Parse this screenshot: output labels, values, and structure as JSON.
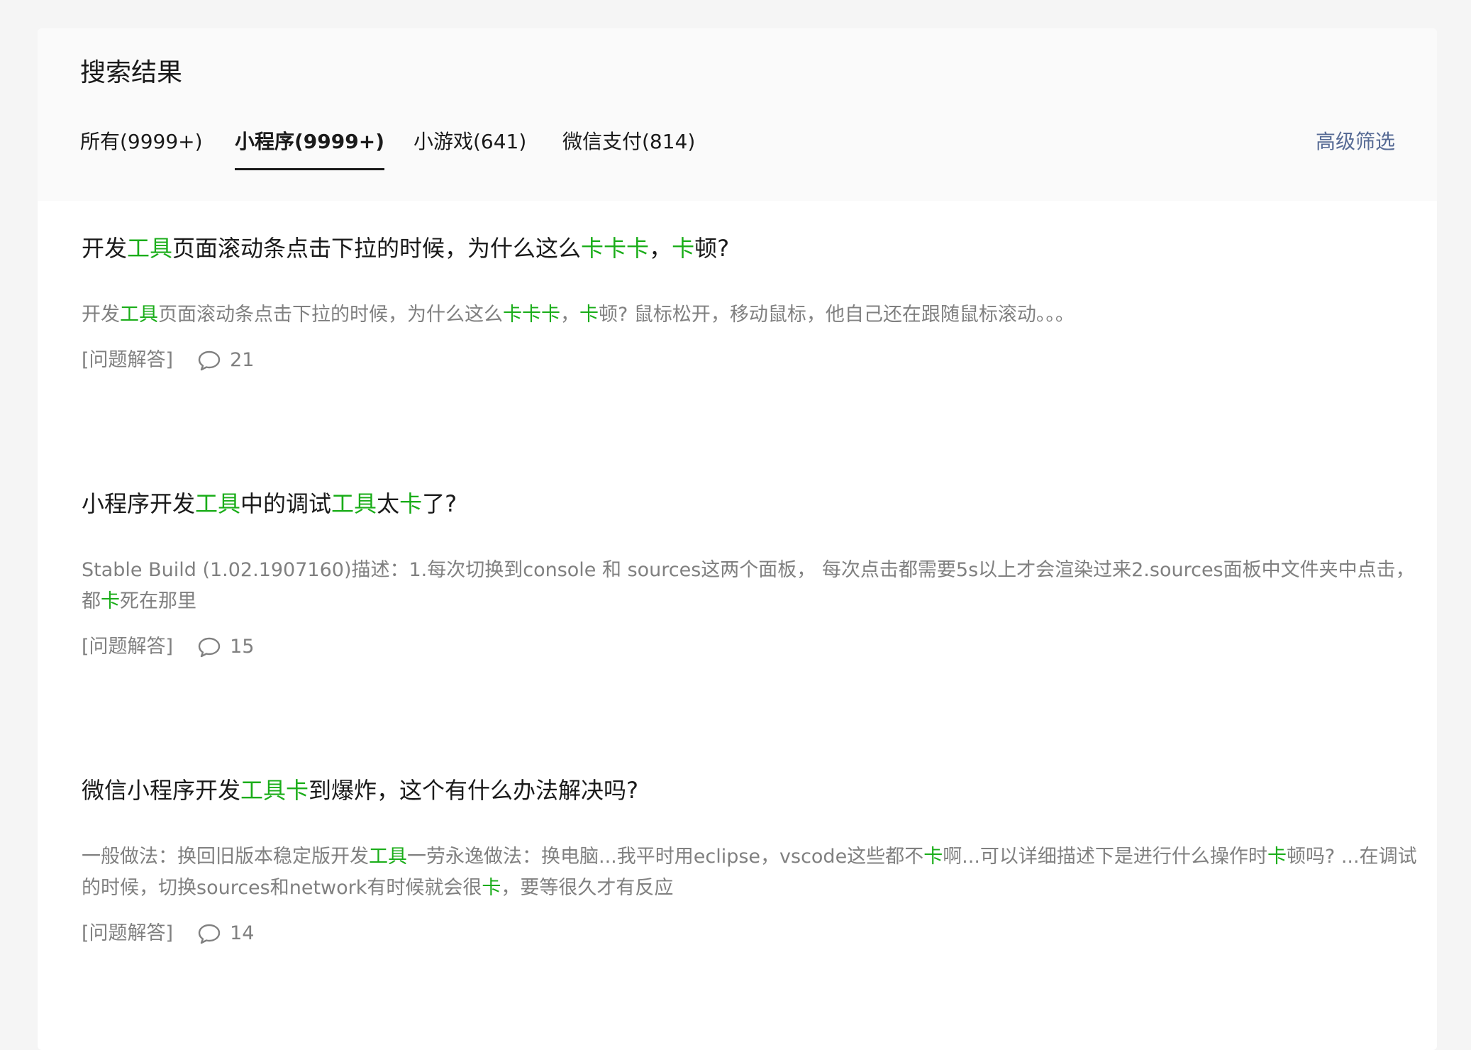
{
  "page_title": "搜索结果",
  "tabs": [
    {
      "label": "所有(9999+)",
      "active": false
    },
    {
      "label": "小程序(9999+)",
      "active": true
    },
    {
      "label": "小游戏(641)",
      "active": false
    },
    {
      "label": "微信支付(814)",
      "active": false
    }
  ],
  "filter_label": "高级筛选",
  "colors": {
    "highlight": "#1aad19",
    "link": "#576b95",
    "muted": "#808080"
  },
  "results": [
    {
      "title": [
        {
          "t": "开发"
        },
        {
          "t": "工具",
          "hl": true
        },
        {
          "t": "页面滚动条点击下拉的时候，为什么这么"
        },
        {
          "t": "卡卡卡",
          "hl": true
        },
        {
          "t": "，"
        },
        {
          "t": "卡",
          "hl": true
        },
        {
          "t": "顿?"
        }
      ],
      "desc": [
        {
          "t": "开发"
        },
        {
          "t": "工具",
          "hl": true
        },
        {
          "t": "页面滚动条点击下拉的时候，为什么这么"
        },
        {
          "t": "卡卡卡",
          "hl": true
        },
        {
          "t": "，"
        },
        {
          "t": "卡",
          "hl": true
        },
        {
          "t": "顿? 鼠标松开，移动鼠标，他自己还在跟随鼠标滚动。。。"
        }
      ],
      "category": "[问题解答]",
      "comments": "21"
    },
    {
      "title": [
        {
          "t": "小程序开发"
        },
        {
          "t": "工具",
          "hl": true
        },
        {
          "t": "中的调试"
        },
        {
          "t": "工具",
          "hl": true
        },
        {
          "t": "太"
        },
        {
          "t": "卡",
          "hl": true
        },
        {
          "t": "了?"
        }
      ],
      "desc": [
        {
          "t": "Stable Build (1.02.1907160)描述：1.每次切换到console 和 sources这两个面板， 每次点击都需要5s以上才会渲染过来2.sources面板中文件夹中点击，都"
        },
        {
          "t": "卡",
          "hl": true
        },
        {
          "t": "死在那里"
        }
      ],
      "category": "[问题解答]",
      "comments": "15"
    },
    {
      "title": [
        {
          "t": "微信小程序开发"
        },
        {
          "t": "工具卡",
          "hl": true
        },
        {
          "t": "到爆炸，这个有什么办法解决吗?"
        }
      ],
      "desc": [
        {
          "t": "一般做法：换回旧版本稳定版开发"
        },
        {
          "t": "工具",
          "hl": true
        },
        {
          "t": "一劳永逸做法：换电脑...我平时用eclipse，vscode这些都不"
        },
        {
          "t": "卡",
          "hl": true
        },
        {
          "t": "啊...可以详细描述下是进行什么操作时"
        },
        {
          "t": "卡",
          "hl": true
        },
        {
          "t": "顿吗? ...在调试的时候，切换sources和network有时候就会很"
        },
        {
          "t": "卡",
          "hl": true
        },
        {
          "t": "，要等很久才有反应"
        }
      ],
      "category": "[问题解答]",
      "comments": "14"
    }
  ]
}
